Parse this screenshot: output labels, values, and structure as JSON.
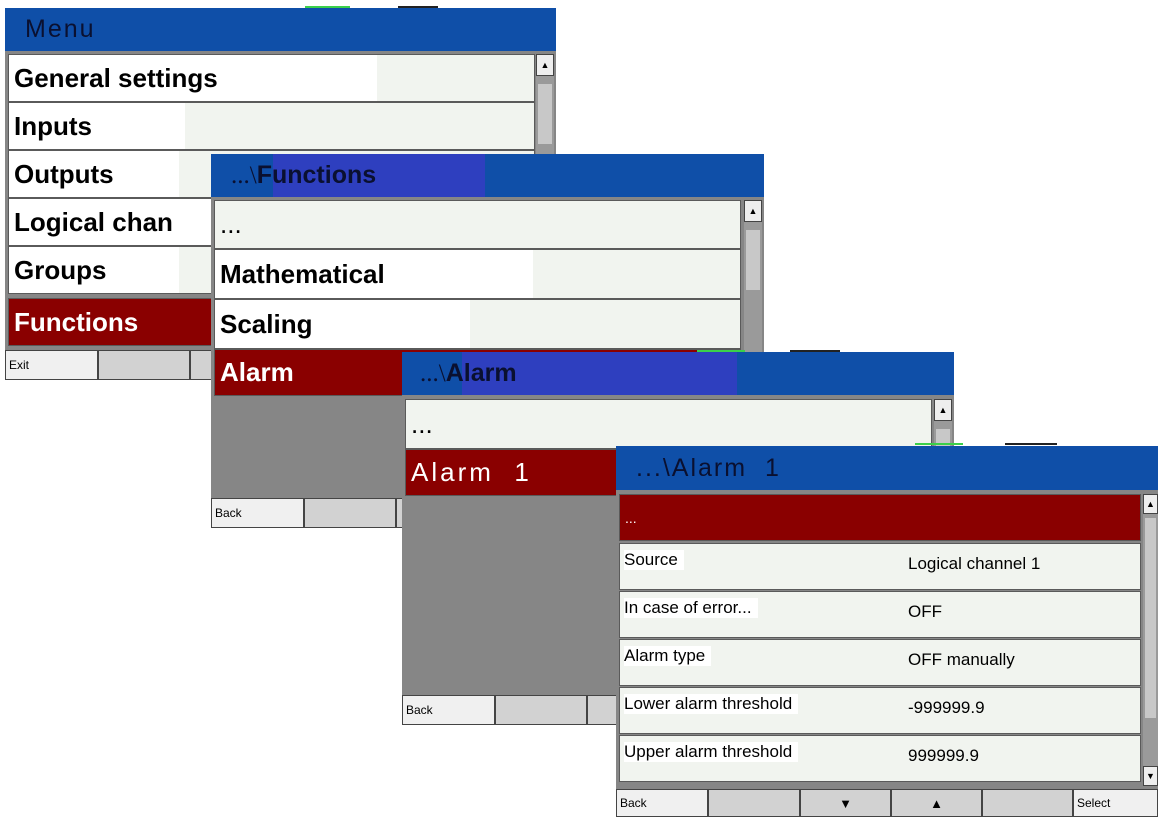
{
  "menu": {
    "title": "Menu",
    "items": [
      "General settings",
      "Inputs",
      "Outputs",
      "Logical chan",
      "Groups",
      "Functions"
    ],
    "selected": "Functions",
    "softkeys": [
      "Exit",
      ""
    ]
  },
  "functions": {
    "title_prefix": "...\\",
    "title": "Functions",
    "items": [
      "...",
      "Mathematical",
      "Scaling",
      "Alarm"
    ],
    "selected": "Alarm",
    "softkeys": [
      "Back",
      "",
      ""
    ]
  },
  "alarm": {
    "title_prefix": "...\\",
    "title": "Alarm",
    "items": [
      "...",
      "Alarm  1"
    ],
    "selected": "Alarm  1",
    "softkeys": [
      "Back",
      "",
      ""
    ]
  },
  "alarm1": {
    "title": "...\\Alarm  1",
    "top_row": "...",
    "rows": [
      {
        "label": "Source",
        "value": "Logical channel 1"
      },
      {
        "label": "In case of error...",
        "value": "OFF"
      },
      {
        "label": "Alarm type",
        "value": "OFF manually"
      },
      {
        "label": "Lower alarm threshold",
        "value": "-999999.9"
      },
      {
        "label": "Upper alarm threshold",
        "value": "999999.9"
      }
    ],
    "softkeys": [
      "Back",
      "",
      "▼",
      "▲",
      "",
      "Select"
    ]
  },
  "colors": {
    "header": "#0f4fa8",
    "selected": "#8a0000",
    "item_bg": "#f1f4ef",
    "panel_bg": "#868686"
  }
}
